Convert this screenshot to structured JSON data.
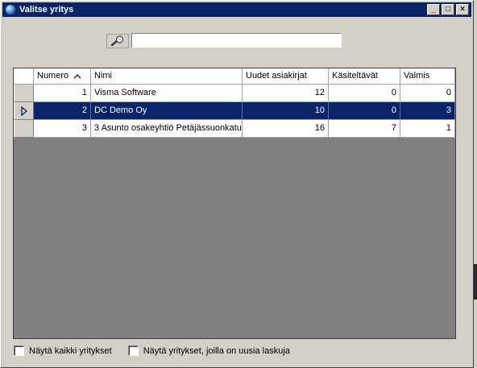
{
  "window": {
    "title": "Valitse yritys",
    "buttons": {
      "minimize": "_",
      "maximize": "□",
      "close": "×"
    }
  },
  "search": {
    "value": "",
    "placeholder": ""
  },
  "table": {
    "columns": [
      "Numero",
      "Nimi",
      "Uudet asiakirjat",
      "Käsiteltävät",
      "Valmis"
    ],
    "sort_column": "Numero",
    "sort_direction": "ascending",
    "rows": [
      {
        "numero": "1",
        "nimi": "Visma Software",
        "uudet": "12",
        "kasiteltavat": "0",
        "valmis": "0",
        "selected": false
      },
      {
        "numero": "2",
        "nimi": "DC Demo Oy",
        "uudet": "10",
        "kasiteltavat": "0",
        "valmis": "3",
        "selected": true
      },
      {
        "numero": "3",
        "nimi": "3 Asunto osakeyhtiö Petäjässuonkatu",
        "uudet": "16",
        "kasiteltavat": "7",
        "valmis": "1",
        "selected": false
      }
    ]
  },
  "footer": {
    "checkbox1_label": "Näytä kaikki yritykset",
    "checkbox1_checked": false,
    "checkbox2_label": "Näytä yritykset, joilla on uusia laskuja",
    "checkbox2_checked": false
  },
  "colors": {
    "titlebar": "#0a246a",
    "selection": "#0a246a",
    "face": "#d4d0c8",
    "grid_background": "#808080"
  },
  "icons": {
    "app": "globe-icon",
    "search": "magnifier-icon",
    "sort": "sort-ascending-icon",
    "row_pointer": "row-pointer-icon"
  }
}
